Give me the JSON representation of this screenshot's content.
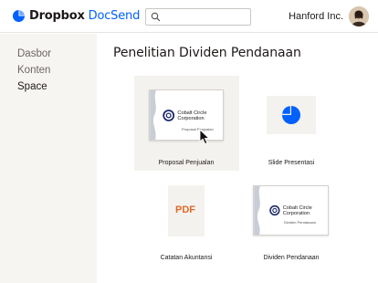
{
  "header": {
    "brand": "Dropbox",
    "product": "DocSend",
    "search_placeholder": "",
    "user_name": "Hanford Inc."
  },
  "sidebar": {
    "items": [
      {
        "label": "Dasbor",
        "active": false
      },
      {
        "label": "Konten",
        "active": false
      },
      {
        "label": "Space",
        "active": true
      }
    ]
  },
  "main": {
    "title": "Penelitian Dividen Pendanaan",
    "files": [
      {
        "label": "Proposal Penjualan",
        "icon": "cobalt-doc-icon",
        "thumb_company": "Cobalt Circle Corporation",
        "thumb_caption": "Proposal Penjualan",
        "selected": true
      },
      {
        "label": "Slide Presentasi",
        "icon": "pie-chart-icon"
      },
      {
        "label": "Catatan Akuntansi",
        "icon": "pdf-icon",
        "thumb_text": "PDF"
      },
      {
        "label": "Dividen Pendanaan",
        "icon": "cobalt-doc-icon",
        "thumb_company": "Cobalt Circle Corporation",
        "thumb_caption": "Dividen Pendanaan"
      }
    ]
  },
  "colors": {
    "accent": "#0061fe",
    "pdf": "#e0692b",
    "sidebar_bg": "#f7f5f2"
  }
}
